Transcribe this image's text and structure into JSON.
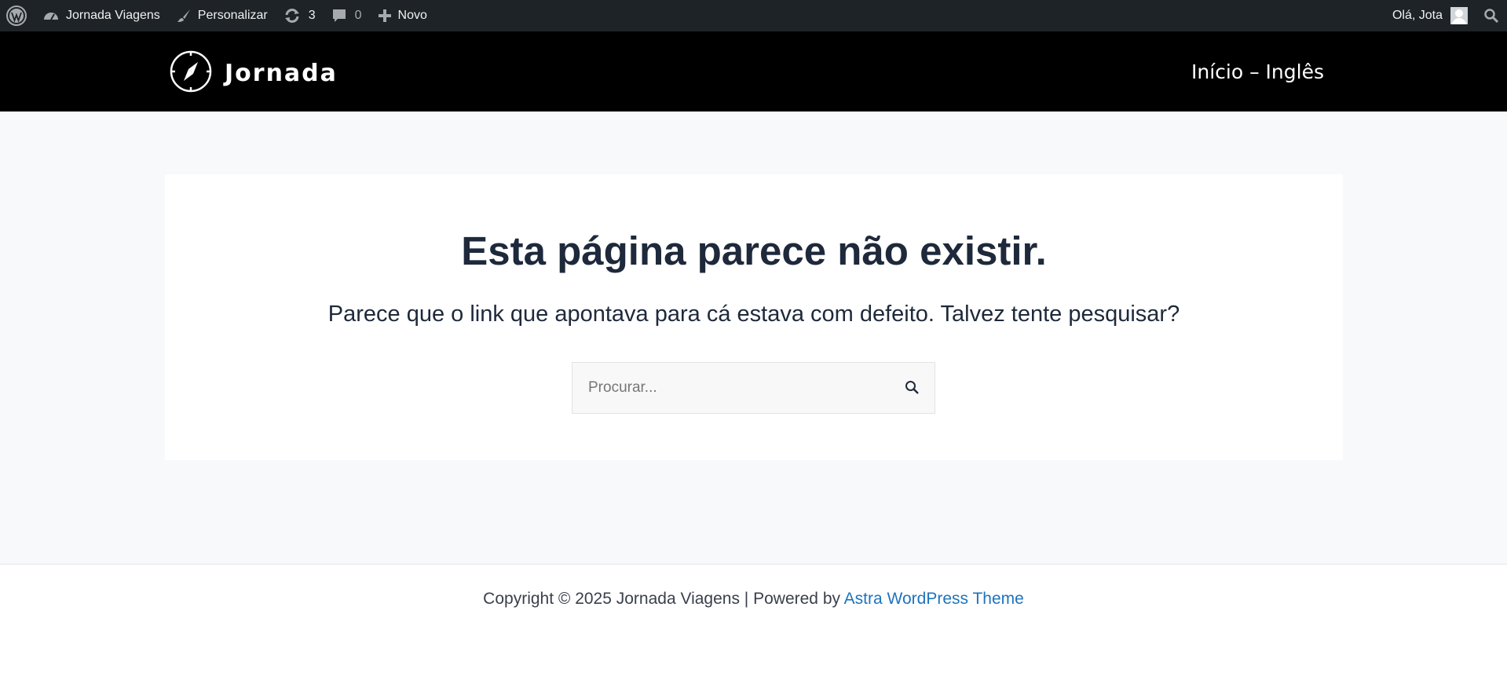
{
  "admin_bar": {
    "wp_logo_icon": "wordpress-icon",
    "site_name": "Jornada Viagens",
    "customize_label": "Personalizar",
    "updates_count": "3",
    "comments_count": "0",
    "new_label": "Novo",
    "greeting": "Olá, Jota"
  },
  "header": {
    "logo_text": "Jornada",
    "nav_link": "Início – Inglês"
  },
  "error_page": {
    "title": "Esta página parece não existir.",
    "message": "Parece que o link que apontava para cá estava com defeito. Talvez tente pesquisar?",
    "search_placeholder": "Procurar..."
  },
  "footer": {
    "copyright": "Copyright © 2025 Jornada Viagens | Powered by ",
    "theme_link": "Astra WordPress Theme"
  },
  "colors": {
    "admin_bar_bg": "#1d2327",
    "header_bg": "#000000",
    "page_bg": "#f8f9fa",
    "link": "#1e73be"
  }
}
